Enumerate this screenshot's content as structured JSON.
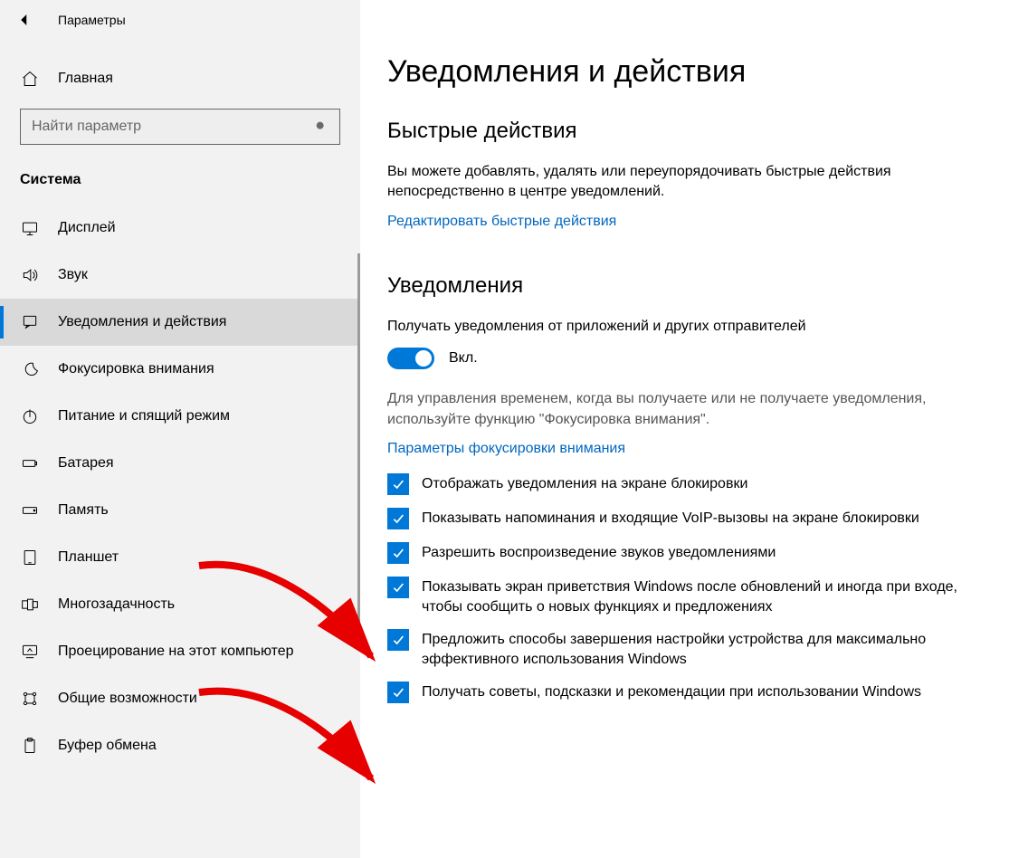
{
  "window": {
    "title": "Параметры"
  },
  "sidebar": {
    "home": "Главная",
    "search_placeholder": "Найти параметр",
    "section": "Система",
    "items": [
      {
        "id": "display",
        "label": "Дисплей"
      },
      {
        "id": "sound",
        "label": "Звук"
      },
      {
        "id": "notifications",
        "label": "Уведомления и действия"
      },
      {
        "id": "focus",
        "label": "Фокусировка внимания"
      },
      {
        "id": "power",
        "label": "Питание и спящий режим"
      },
      {
        "id": "battery",
        "label": "Батарея"
      },
      {
        "id": "storage",
        "label": "Память"
      },
      {
        "id": "tablet",
        "label": "Планшет"
      },
      {
        "id": "multitask",
        "label": "Многозадачность"
      },
      {
        "id": "projecting",
        "label": "Проецирование на этот компьютер"
      },
      {
        "id": "shared",
        "label": "Общие возможности"
      },
      {
        "id": "clipboard",
        "label": "Буфер обмена"
      }
    ]
  },
  "main": {
    "title": "Уведомления и действия",
    "quick": {
      "heading": "Быстрые действия",
      "desc": "Вы можете добавлять, удалять или переупорядочивать быстрые действия непосредственно в центре уведомлений.",
      "edit_link": "Редактировать быстрые действия"
    },
    "notifications": {
      "heading": "Уведомления",
      "toggle_label": "Получать уведомления от приложений и других отправителей",
      "toggle_state": "Вкл.",
      "focus_hint": "Для управления временем, когда вы получаете или не получаете уведомления, используйте функцию \"Фокусировка внимания\".",
      "focus_link": "Параметры фокусировки внимания",
      "checks": [
        "Отображать уведомления на экране блокировки",
        "Показывать напоминания и входящие VoIP-вызовы на экране блокировки",
        "Разрешить  воспроизведение звуков уведомлениями",
        "Показывать экран приветствия Windows после обновлений и иногда при входе, чтобы сообщить о новых функциях и предложениях",
        "Предложить способы завершения настройки устройства для максимально эффективного использования Windows",
        "Получать советы, подсказки и рекомендации при использовании Windows"
      ]
    }
  }
}
